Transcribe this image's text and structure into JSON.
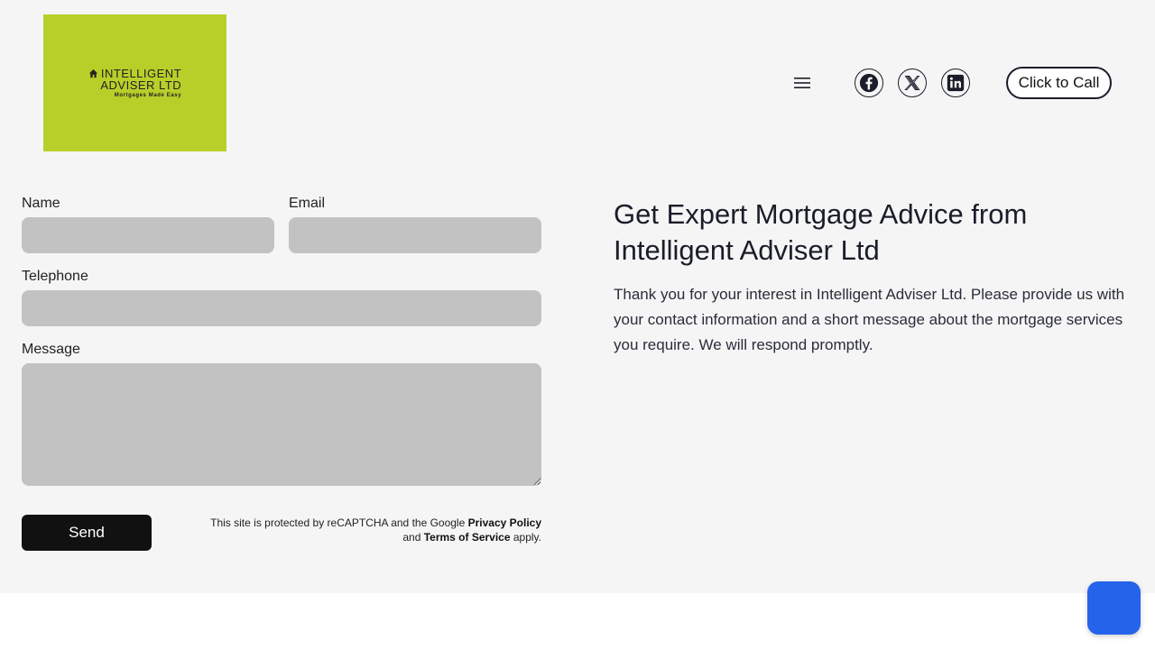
{
  "header": {
    "logo": {
      "line1": "INTELLIGENT",
      "line2": "ADVISER LTD",
      "tagline": "Mortgages Made Easy",
      "bg_color": "#b8cf2a"
    },
    "menu_icon": "hamburger-icon",
    "social": [
      "facebook-icon",
      "x-twitter-icon",
      "linkedin-icon"
    ],
    "call_label": "Click to Call"
  },
  "form": {
    "name_label": "Name",
    "email_label": "Email",
    "telephone_label": "Telephone",
    "message_label": "Message",
    "name_value": "",
    "email_value": "",
    "telephone_value": "",
    "message_value": "",
    "send_label": "Send",
    "recaptcha": {
      "prefix": "This site is protected by reCAPTCHA and the Google ",
      "privacy_link": "Privacy Policy",
      "and": "and ",
      "terms_link": "Terms of Service",
      "suffix": " apply."
    }
  },
  "content": {
    "heading": "Get Expert Mortgage Advice from Intelligent Adviser Ltd",
    "intro": "Thank you for your interest in Intelligent Adviser Ltd. Please provide us with your contact information and a short message about the mortgage services you require. We will respond promptly."
  },
  "colors": {
    "page_bg": "#f5f5f5",
    "field_bg": "#c2c2c2",
    "button_bg": "#111111",
    "chat_widget": "#2563eb",
    "text_dark": "#1a1d29"
  }
}
